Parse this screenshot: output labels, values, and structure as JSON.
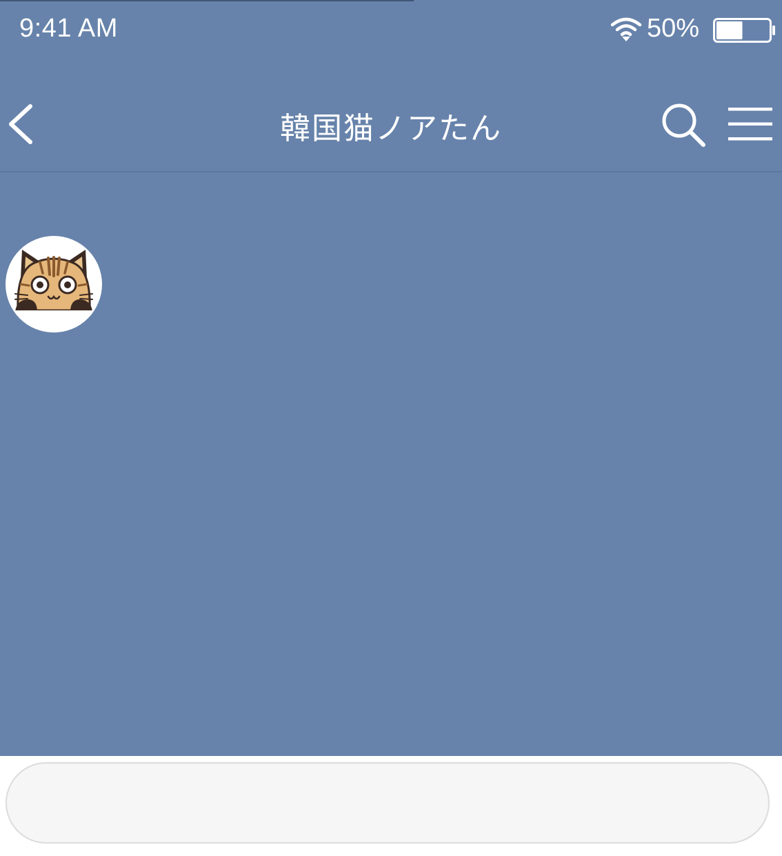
{
  "status_bar": {
    "time": "9:41 AM",
    "battery_percent": "50%",
    "battery_level": 0.5,
    "wifi_icon": "wifi-icon",
    "battery_icon": "battery-icon"
  },
  "header": {
    "title": "韓国猫ノアたん",
    "back_icon": "chevron-left-icon",
    "search_icon": "search-icon",
    "menu_icon": "hamburger-menu-icon"
  },
  "chat": {
    "avatar_icon": "cat-avatar-icon"
  },
  "composer": {
    "value": "",
    "placeholder": ""
  },
  "colors": {
    "background": "#6783ab",
    "header_text": "#ffffff",
    "input_background": "#f5f6f5",
    "input_border": "#dcdcdc"
  }
}
